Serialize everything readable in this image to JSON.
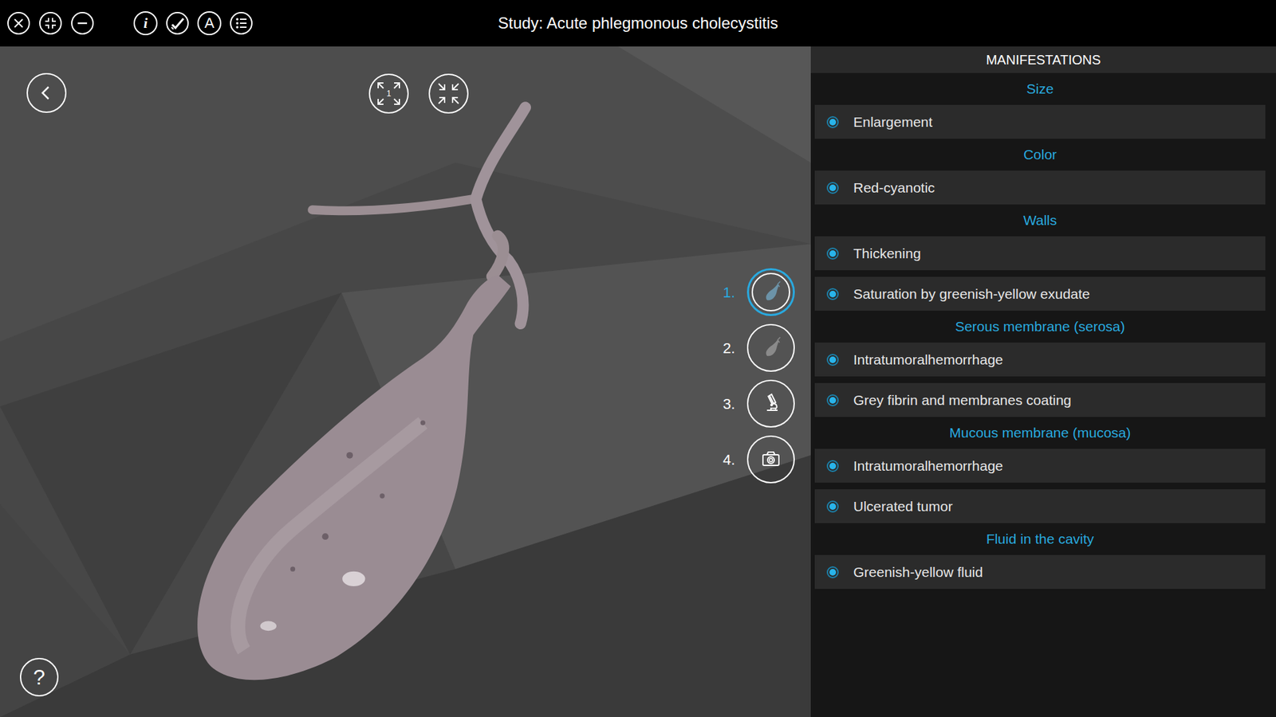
{
  "window": {
    "title": "Study: Acute phlegmonous cholecystitis"
  },
  "toolbar": {
    "info_glyph": "i",
    "font_glyph": "A",
    "fit_view_glyph": "1"
  },
  "help": "?",
  "steps": [
    {
      "number": "1.",
      "selected": true,
      "kind": "gallbladder"
    },
    {
      "number": "2.",
      "selected": false,
      "kind": "gallbladder"
    },
    {
      "number": "3.",
      "selected": false,
      "kind": "microscope"
    },
    {
      "number": "4.",
      "selected": false,
      "kind": "camera"
    }
  ],
  "panel": {
    "title": "MANIFESTATIONS",
    "sections": [
      {
        "heading": "Size",
        "items": [
          {
            "label": "Enlargement",
            "checked": true
          }
        ]
      },
      {
        "heading": "Color",
        "items": [
          {
            "label": "Red-cyanotic",
            "checked": true
          }
        ]
      },
      {
        "heading": "Walls",
        "items": [
          {
            "label": "Thickening",
            "checked": true
          },
          {
            "label": "Saturation by greenish-yellow exudate",
            "checked": true
          }
        ]
      },
      {
        "heading": "Serous membrane (serosa)",
        "items": [
          {
            "label": "Intratumoralhemorrhage",
            "checked": true
          },
          {
            "label": "Grey fibrin and membranes coating",
            "checked": true
          }
        ]
      },
      {
        "heading": "Mucous membrane (mucosa)",
        "items": [
          {
            "label": "Intratumoralhemorrhage",
            "checked": true
          },
          {
            "label": "Ulcerated tumor",
            "checked": true
          }
        ]
      },
      {
        "heading": "Fluid in the cavity",
        "items": [
          {
            "label": "Greenish-yellow fluid",
            "checked": true
          }
        ]
      }
    ]
  }
}
